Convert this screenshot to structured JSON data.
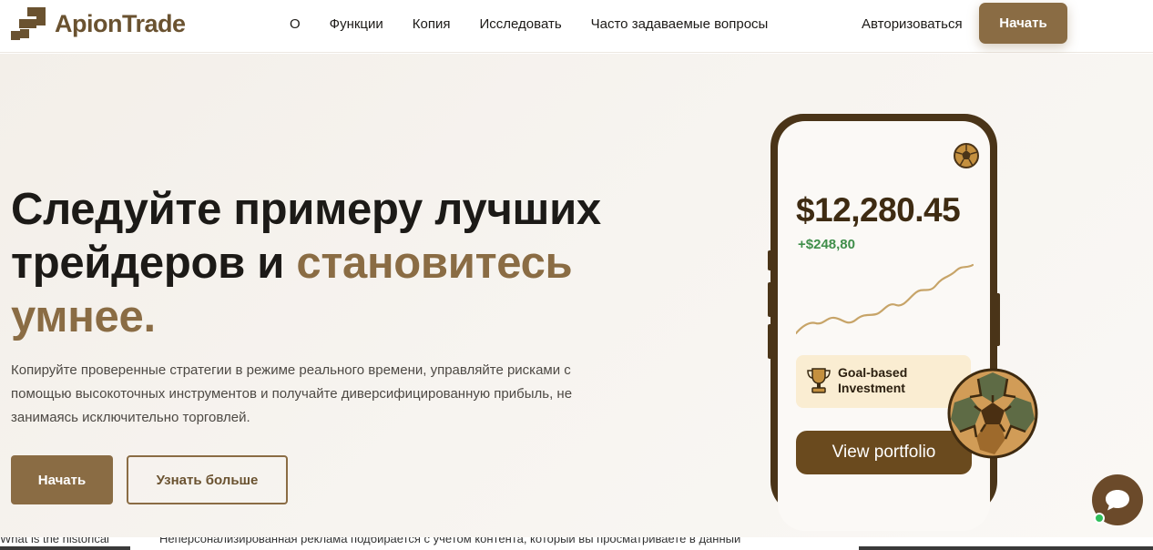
{
  "header": {
    "logo_text": "ApionTrade",
    "nav": [
      "О",
      "Функции",
      "Копия",
      "Исследовать",
      "Часто задаваемые вопросы"
    ],
    "login": "Авторизоваться",
    "start": "Начать"
  },
  "hero": {
    "headline_part1": "Следуйте примеру лучших трейдеров и ",
    "headline_accent": "становитесь умнее.",
    "subtitle": "Копируйте проверенные стратегии в режиме реального времени, управляйте рисками с помощью высокоточных инструментов и получайте диверсифицированную прибыль, не занимаясь исключительно торговлей.",
    "start_button": "Начать",
    "more_button": "Узнать больше"
  },
  "phone": {
    "balance": "$12,280.45",
    "change": "+$248,80",
    "goal_line1": "Goal-based",
    "goal_line2": "Investment",
    "view_button": "View portfolio"
  },
  "cookie_strip": {
    "left_text": "What is the historical",
    "main_text": "Неперсонализированная реклама подбирается с учетом контента, который вы просматриваете в данный"
  },
  "colors": {
    "brand": "#8a6c44",
    "brand_dark": "#6a5230",
    "positive": "#3f8e4a",
    "phone_frame": "#4a3418"
  },
  "icons": [
    "logo-mark-icon",
    "soccer-ball-icon",
    "trophy-icon",
    "chat-bubble-icon"
  ]
}
